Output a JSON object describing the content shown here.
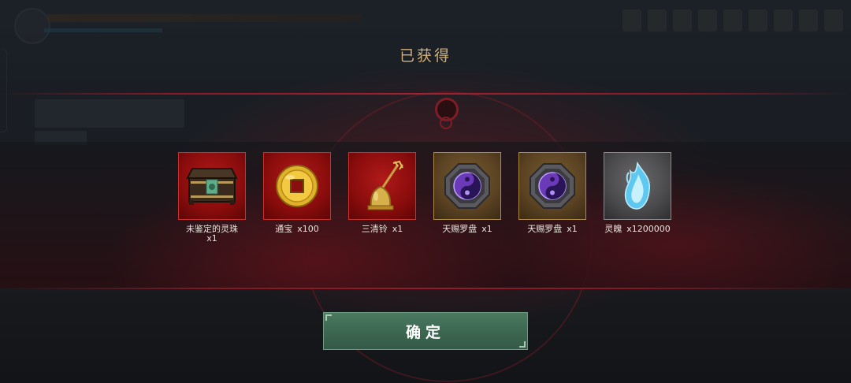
{
  "dialog": {
    "title": "已获得",
    "confirm_label": "确定"
  },
  "rewards": [
    {
      "name": "未鉴定的灵珠",
      "qty": "x1",
      "rarity": "red",
      "icon": "treasure-chest-icon"
    },
    {
      "name": "通宝",
      "qty": "x100",
      "rarity": "red",
      "icon": "gold-coin-icon"
    },
    {
      "name": "三清铃",
      "qty": "x1",
      "rarity": "red",
      "icon": "trident-bell-icon"
    },
    {
      "name": "天赐罗盘",
      "qty": "x1",
      "rarity": "gold",
      "icon": "compass-orb-icon"
    },
    {
      "name": "天赐罗盘",
      "qty": "x1",
      "rarity": "gold",
      "icon": "compass-orb-icon"
    },
    {
      "name": "灵魄",
      "qty": "x1200000",
      "rarity": "gray",
      "icon": "spirit-flame-icon"
    }
  ],
  "colors": {
    "title": "#d2b27a",
    "accent_red": "#a42232",
    "confirm_green": "#3c6650",
    "rarity_red": "#8a0c0c",
    "rarity_gold": "#5a4222",
    "rarity_gray": "#4a4a4c"
  }
}
